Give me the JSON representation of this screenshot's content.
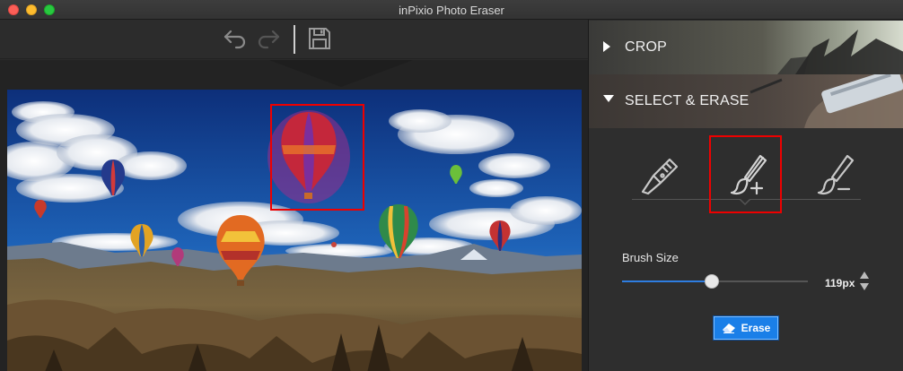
{
  "window": {
    "title": "inPixio Photo Eraser"
  },
  "toolbar": {
    "undo_icon": "undo-arrow-icon",
    "redo_icon": "redo-arrow-icon",
    "save_icon": "floppy-disk-icon"
  },
  "panel": {
    "crop": {
      "label": "CROP",
      "expanded": false
    },
    "select_erase": {
      "label": "SELECT & ERASE",
      "expanded": true
    },
    "tools": [
      {
        "name": "cutter-tool",
        "icon": "utility-knife-icon",
        "selected": false
      },
      {
        "name": "brush-add-tool",
        "icon": "brush-plus-icon",
        "selected": true
      },
      {
        "name": "brush-remove-tool",
        "icon": "brush-minus-icon",
        "selected": false
      }
    ],
    "brush_size": {
      "label": "Brush Size",
      "value": "119px",
      "level": 0.48
    },
    "erase_button": {
      "label": "Erase",
      "icon": "eraser-icon"
    }
  },
  "colors": {
    "accent": "#1a7fe8",
    "highlight": "#ee0000",
    "slider_fill": "#2e7de0"
  }
}
